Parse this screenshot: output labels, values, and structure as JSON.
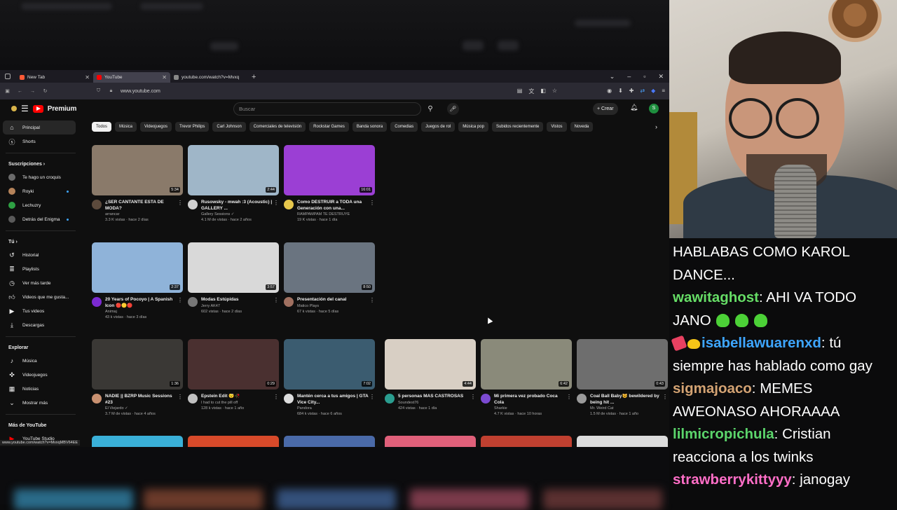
{
  "browser": {
    "tabs": [
      {
        "label": "New Tab",
        "color": "#ff5a36"
      },
      {
        "label": "YouTube",
        "color": "#ff0000"
      },
      {
        "label": "youtube.com/watch?v=Mvxq"
      }
    ],
    "url": "www.youtube.com",
    "status_url": "www.youtube.com/watch?v=MvxqMBV64EE"
  },
  "youtube": {
    "logo": "Premium",
    "search_placeholder": "Buscar",
    "create_label": "+ Crear",
    "avatar_letter": "S",
    "chips": [
      "Todos",
      "Música",
      "Videojuegos",
      "Trevor Philips",
      "Carl Johnson",
      "Comerciales de televisión",
      "Rockstar Games",
      "Banda sonora",
      "Comedias",
      "Juegos de rol",
      "Música pop",
      "Subidos recientemente",
      "Vistos",
      "Noveda"
    ],
    "sidebar": {
      "main": [
        {
          "label": "Principal",
          "icon": "home-icon"
        },
        {
          "label": "Shorts",
          "icon": "shorts-icon"
        }
      ],
      "subs_title": "Suscripciones ›",
      "subs": [
        {
          "label": "Te hago un croquis",
          "color": "#6b6b6b",
          "dot": false
        },
        {
          "label": "Royki",
          "color": "#b5835a",
          "dot": true
        },
        {
          "label": "Lechuzry",
          "color": "#2ea043",
          "dot": false
        },
        {
          "label": "Detrás del Enigma",
          "color": "#5a5a5a",
          "dot": true
        }
      ],
      "you_title": "Tú ›",
      "you": [
        "Historial",
        "Playlists",
        "Ver más tarde",
        "Videos que me gusta...",
        "Tus videos",
        "Descargas"
      ],
      "explore_title": "Explorar",
      "explore": [
        "Música",
        "Videojuegos",
        "Noticias",
        "Mostrar más"
      ],
      "more_title": "Más de YouTube",
      "more": [
        "YouTube Studio"
      ]
    },
    "videos": [
      {
        "title": "¿SER CANTANTE ESTA DE MODA?",
        "channel": "arrancar",
        "stats": "3.3 K vistas · hace 2 días",
        "duration": "5:34",
        "thumb": "#8a7a6a",
        "avatar": "#5c4a3c"
      },
      {
        "title": "Rusowsky - mwah :3 (Acoustic) | GALLERY ...",
        "channel": "Gallery Sessions ✓",
        "stats": "4.1 M de vistas · hace 2 años",
        "duration": "2:44",
        "thumb": "#9fb6c8",
        "avatar": "#d0d0d0"
      },
      {
        "title": "Como DESTRUIR a TODA una Generación con una...",
        "channel": "RAMPAMPAM TE DESTRUYE",
        "stats": "19 K vistas · hace 1 día",
        "duration": "16:01",
        "thumb": "#9b3fd4",
        "avatar": "#e6c74c"
      },
      {
        "title": "20 Years of Pocoyo | A Spanish Icon 🔴🟡🔴",
        "channel": "Animaj",
        "stats": "43 k vistas · hace 3 días",
        "duration": "2:37",
        "thumb": "#8fb3d9",
        "avatar": "#7b2ad1"
      },
      {
        "title": "Modas Estúpidas",
        "channel": "Jerry AK47",
        "stats": "602 vistas · hace 2 días",
        "duration": "3:57",
        "thumb": "#d9d9d9",
        "avatar": "#777777"
      },
      {
        "title": "Presentación del canal",
        "channel": "Matico Plays",
        "stats": "67 k vistas · hace 5 días",
        "duration": "8:50",
        "thumb": "#6a7480",
        "avatar": "#a07060"
      },
      {
        "title": "NADIE || BZRP Music Sessions #23",
        "channel": "El Viejardo ✓",
        "stats": "3.7 M de vistas · hace 4 años",
        "duration": "1:36",
        "thumb": "#3a3835",
        "avatar": "#c89070"
      },
      {
        "title": "Epstein Edit 😴🥀",
        "channel": "I had to cut the pill off",
        "stats": "128 k vistas · hace 1 año",
        "duration": "0:29",
        "thumb": "#4a3030",
        "avatar": "#c0c0c0"
      },
      {
        "title": "Mantén cerca a tus amigos | GTA Vice City...",
        "channel": "Pandora",
        "stats": "684 k vistas · hace 6 años",
        "duration": "7:02",
        "thumb": "#3b5c70",
        "avatar": "#dddddd"
      },
      {
        "title": "5 personas MAS CASTROSAS",
        "channel": "Soundest76",
        "stats": "424 vistas · hace 1 día",
        "duration": "4:44",
        "thumb": "#d8cfc4",
        "avatar": "#2a9d8f"
      },
      {
        "title": "Mi primera vez probado Coca Cola",
        "channel": "Sharkie",
        "stats": "4.7 K vistas · hace 10 horas",
        "duration": "6:42",
        "thumb": "#8a8a7a",
        "avatar": "#7b4ad1"
      },
      {
        "title": "Coal Ball Baby😺 bewildered by being hit ...",
        "channel": "Mr. Weird Cat",
        "stats": "1.5 M de vistas · hace 1 año",
        "duration": "0:43",
        "thumb": "#6e6e6e",
        "avatar": "#9a9a9a"
      }
    ],
    "bottom_thumbs": [
      "#3ab0d8",
      "#d84a2a",
      "#4a6aa8",
      "#e0607a",
      "#c04030",
      "#dcdcdc"
    ]
  },
  "chat": [
    {
      "user": "",
      "text": "HABLABAS COMO KAROL DANCE...",
      "color": "#ffffff"
    },
    {
      "user": "wawitaghost",
      "text": ": AHI VA TODO JANO",
      "color": "#66dd66",
      "blobs": 3
    },
    {
      "user": "isabellawuarenxd",
      "text": ": tú siempre has hablado como gay",
      "color": "#3ea6ff",
      "badges": true
    },
    {
      "user": "sigmajoaco",
      "text": ": MEMES AWEONASO AHORAAAA",
      "color": "#d4a373"
    },
    {
      "user": "lilmicropichula",
      "text": ": Cristian reacciona a los twinks",
      "color": "#5bd46b"
    },
    {
      "user": "strawberrykittyyy",
      "text": ": janogay",
      "color": "#ff6ec7"
    }
  ]
}
